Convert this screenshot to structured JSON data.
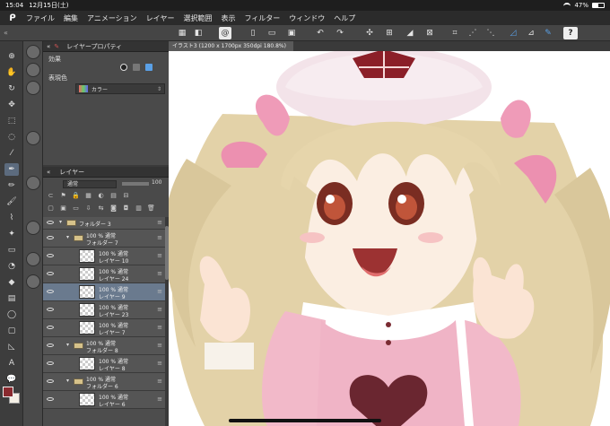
{
  "status_bar": {
    "time": "15:04",
    "date": "12月15日(土)",
    "battery": "47%",
    "battery_level": 0.47
  },
  "menu": {
    "logo": "ᑭ",
    "items": [
      "ファイル",
      "編集",
      "アニメーション",
      "レイヤー",
      "選択範囲",
      "表示",
      "フィルター",
      "ウィンドウ",
      "ヘルプ"
    ]
  },
  "command_bar": {
    "collapse": "«",
    "icons": [
      "grid-icon",
      "layers-icon",
      "spiral-icon",
      "new-file-icon",
      "open-icon",
      "save-icon",
      "undo-icon",
      "redo-icon",
      "transform-icon",
      "mesh-icon",
      "fill-icon",
      "deselect-icon",
      "crop-icon",
      "snap-icon",
      "ruler-icon",
      "pen-pressure-icon",
      "help-icon"
    ],
    "help_label": "?"
  },
  "property_panel": {
    "tab_title": "レイヤープロパティ",
    "effect_label": "効果",
    "expression_color_label": "表現色",
    "expression_color_value": "カラー"
  },
  "layer_panel": {
    "tab_title": "レイヤー",
    "blend_mode": "通常",
    "opacity": "100",
    "opacity_fraction": 1.0,
    "rows": [
      {
        "type": "folder",
        "line1": "フォルダー 3",
        "line2": "",
        "level": 0,
        "selected": false
      },
      {
        "type": "folder",
        "line1": "100 % 通常",
        "line2": "フォルダー 7",
        "level": 1,
        "selected": false
      },
      {
        "type": "layer",
        "line1": "100 % 通常",
        "line2": "レイヤー 10",
        "level": 1,
        "selected": false
      },
      {
        "type": "layer",
        "line1": "100 % 通常",
        "line2": "レイヤー 24",
        "level": 1,
        "selected": false
      },
      {
        "type": "layer",
        "line1": "100 % 通常",
        "line2": "レイヤー 9",
        "level": 1,
        "selected": true
      },
      {
        "type": "layer",
        "line1": "100 % 通常",
        "line2": "レイヤー 23",
        "level": 1,
        "selected": false
      },
      {
        "type": "layer",
        "line1": "100 % 通常",
        "line2": "レイヤー 7",
        "level": 1,
        "selected": false
      },
      {
        "type": "folder",
        "line1": "100 % 通常",
        "line2": "フォルダー 8",
        "level": 1,
        "selected": false
      },
      {
        "type": "layer",
        "line1": "100 % 通常",
        "line2": "レイヤー 8",
        "level": 1,
        "selected": false
      },
      {
        "type": "folder",
        "line1": "100 % 通常",
        "line2": "フォルダー 6",
        "level": 1,
        "selected": false
      },
      {
        "type": "layer",
        "line1": "100 % 通常",
        "line2": "レイヤー 6",
        "level": 1,
        "selected": false
      }
    ]
  },
  "canvas": {
    "tab_title": "イラスト3 (1200 x 1700px 350dpi 180.8%)"
  },
  "colors": {
    "main_color": "#8a2a2f",
    "sub_color": "#f5f0e6",
    "accent": "#5aa0e6"
  }
}
